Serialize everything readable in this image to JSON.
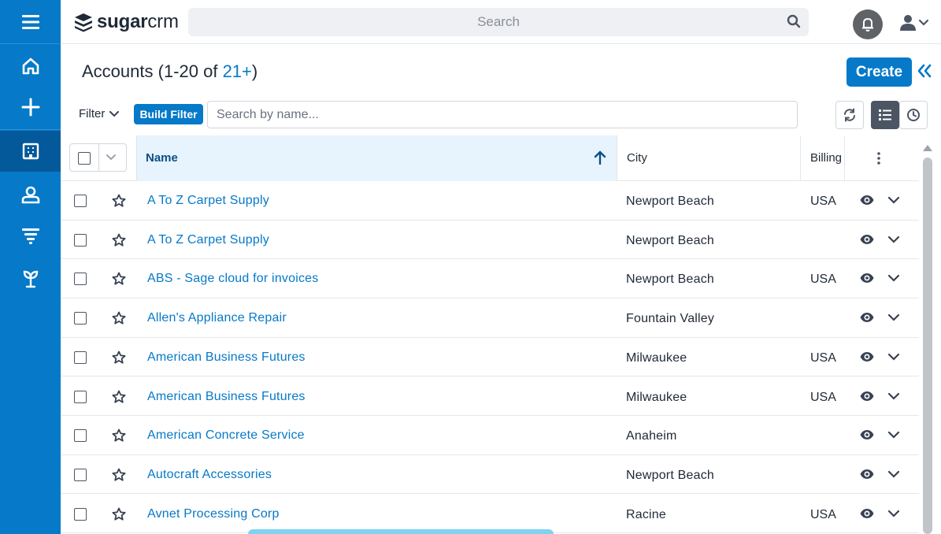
{
  "app": {
    "logo_bold": "sugar",
    "logo_light": "crm"
  },
  "top": {
    "search_placeholder": "Search"
  },
  "header": {
    "title_prefix": "Accounts",
    "title_range": "(1-20 of ",
    "title_count": "21+",
    "title_suffix": ")",
    "create_label": "Create"
  },
  "filter": {
    "label": "Filter",
    "build_label": "Build Filter",
    "search_placeholder": "Search by name..."
  },
  "table": {
    "columns": {
      "name": "Name",
      "city": "City",
      "billing": "Billing"
    },
    "rows": [
      {
        "name": "A To Z Carpet Supply",
        "city": "Newport Beach",
        "billing": "USA"
      },
      {
        "name": "A To Z Carpet Supply",
        "city": "Newport Beach",
        "billing": ""
      },
      {
        "name": "ABS - Sage cloud for invoices",
        "city": "Newport Beach",
        "billing": "USA"
      },
      {
        "name": "Allen's Appliance Repair",
        "city": "Fountain Valley",
        "billing": ""
      },
      {
        "name": "American Business Futures",
        "city": "Milwaukee",
        "billing": "USA"
      },
      {
        "name": "American Business Futures",
        "city": "Milwaukee",
        "billing": "USA"
      },
      {
        "name": "American Concrete Service",
        "city": "Anaheim",
        "billing": ""
      },
      {
        "name": "Autocraft Accessories",
        "city": "Newport Beach",
        "billing": ""
      },
      {
        "name": "Avnet Processing Corp",
        "city": "Racine",
        "billing": "USA"
      }
    ]
  },
  "colors": {
    "brand": "#0679c8",
    "sidebar_active": "#04599a"
  },
  "icons": {
    "sidebar": [
      "menu-icon",
      "home-icon",
      "plus-icon",
      "building-icon",
      "contact-icon",
      "funnel-icon",
      "sprout-icon"
    ]
  }
}
